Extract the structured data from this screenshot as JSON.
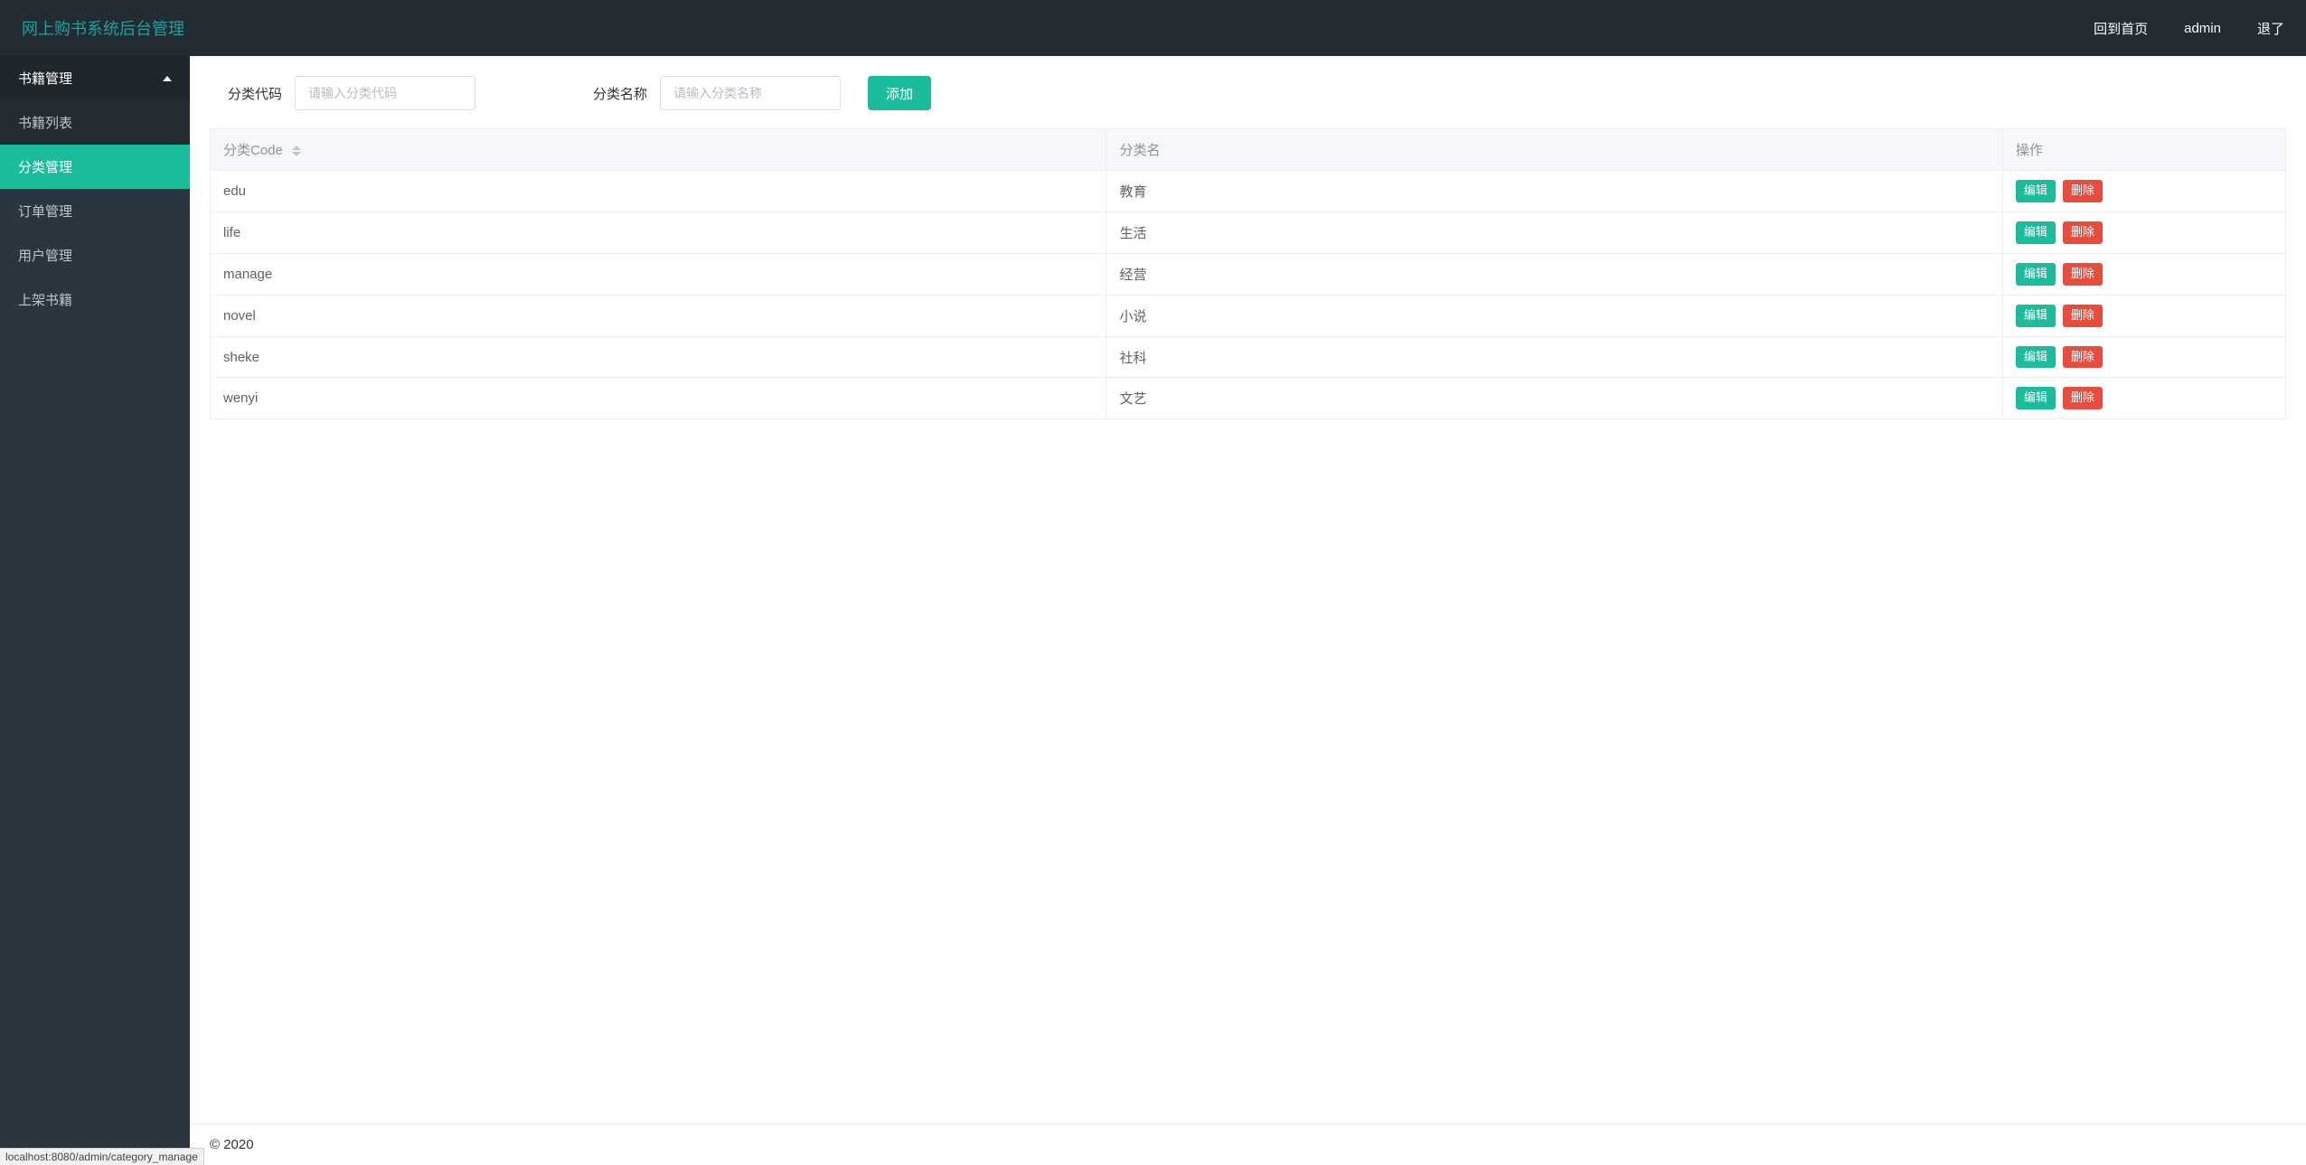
{
  "header": {
    "brand": "网上购书系统后台管理",
    "back_home": "回到首页",
    "user": "admin",
    "logout": "退了"
  },
  "sidebar": {
    "group_label": "书籍管理",
    "items": [
      {
        "label": "书籍列表",
        "sub": true,
        "active": false
      },
      {
        "label": "分类管理",
        "sub": true,
        "active": true
      },
      {
        "label": "订单管理",
        "sub": false,
        "active": false
      },
      {
        "label": "用户管理",
        "sub": false,
        "active": false
      },
      {
        "label": "上架书籍",
        "sub": false,
        "active": false
      }
    ]
  },
  "form": {
    "code_label": "分类代码",
    "code_placeholder": "请输入分类代码",
    "name_label": "分类名称",
    "name_placeholder": "请输入分类名称",
    "add_label": "添加"
  },
  "table": {
    "headers": {
      "code": "分类Code",
      "name": "分类名",
      "op": "操作"
    },
    "edit_label": "编辑",
    "delete_label": "删除",
    "rows": [
      {
        "code": "edu",
        "name": "教育"
      },
      {
        "code": "life",
        "name": "生活"
      },
      {
        "code": "manage",
        "name": "经营"
      },
      {
        "code": "novel",
        "name": "小说"
      },
      {
        "code": "sheke",
        "name": "社科"
      },
      {
        "code": "wenyi",
        "name": "文艺"
      }
    ]
  },
  "footer": {
    "copyright": "© 2020"
  },
  "status_link": "localhost:8080/admin/category_manage"
}
